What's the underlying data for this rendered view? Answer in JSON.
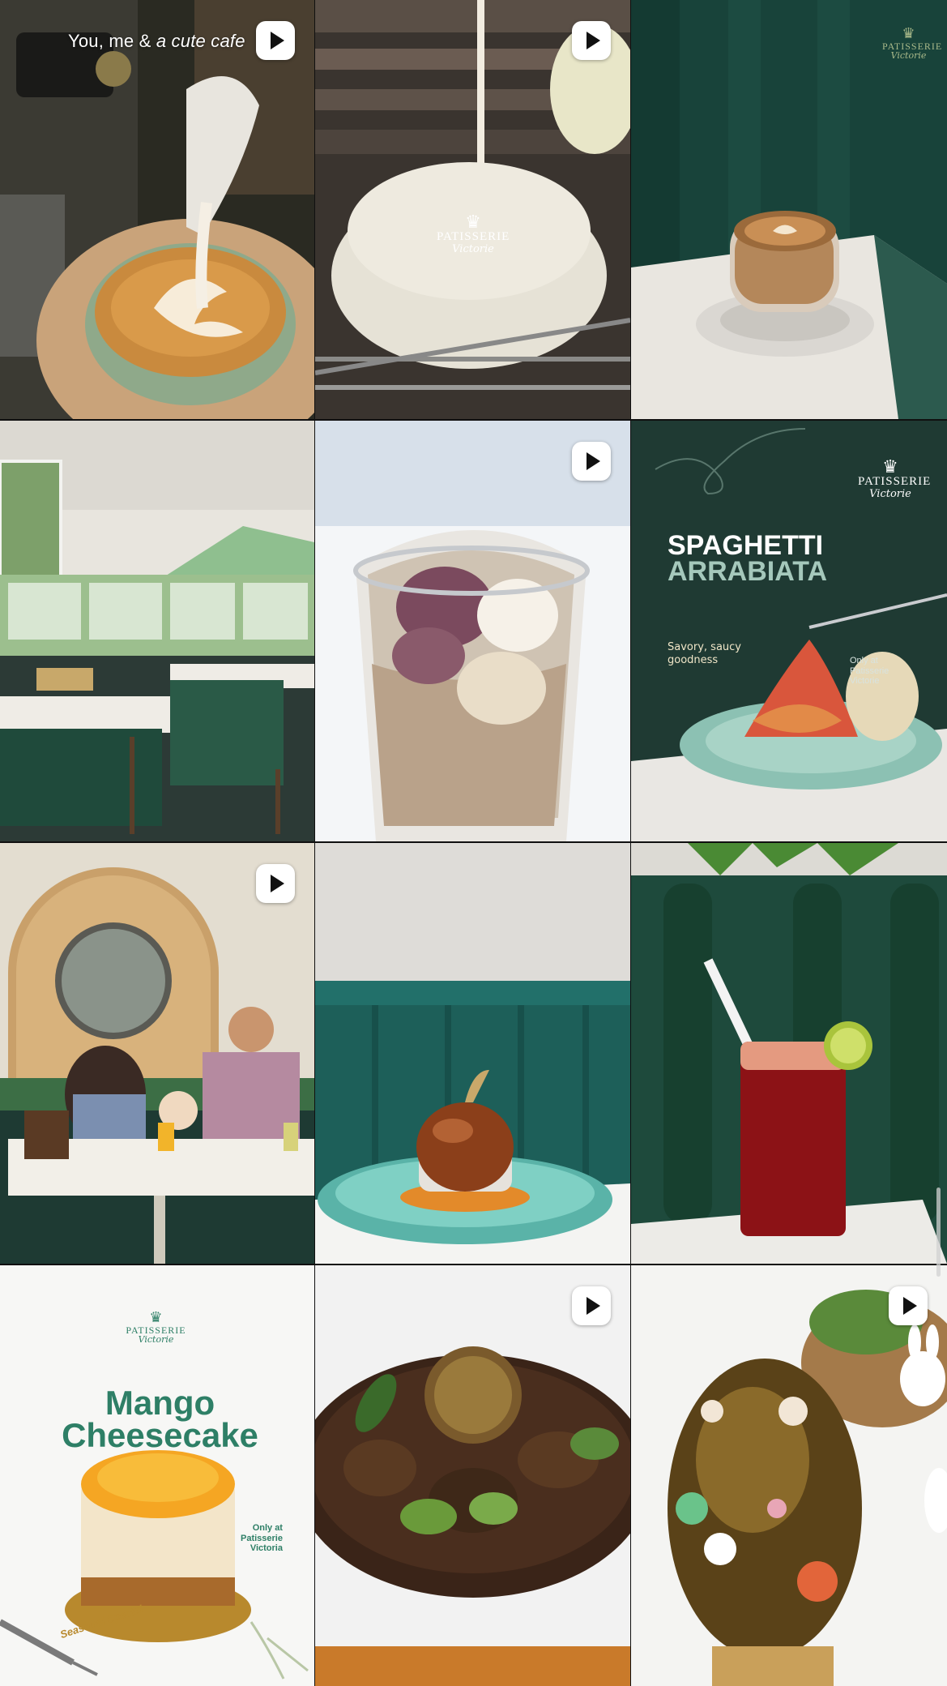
{
  "grid": {
    "tiles": [
      {
        "name": "latte-art-pour",
        "is_reel": true,
        "caption_prefix": "You, me & ",
        "caption_emphasis": "a cute cafe"
      },
      {
        "name": "white-glaze-pour",
        "is_reel": true,
        "brand_name": "PATISSERIE",
        "brand_sub": "Victorie"
      },
      {
        "name": "cappuccino-glass-cup",
        "is_reel": false,
        "brand_name": "PATISSERIE",
        "brand_sub": "Victorie"
      },
      {
        "name": "cafe-interior",
        "is_reel": false
      },
      {
        "name": "rose-iced-latte",
        "is_reel": true
      },
      {
        "name": "spaghetti-arrabiata-post",
        "is_reel": false,
        "brand_name": "PATISSERIE",
        "brand_sub": "Victorie",
        "title_line1": "SPAGHETTI",
        "title_line2": "ARRABIATA",
        "tagline_line1": "Savory, saucy",
        "tagline_line2": "goodness",
        "note_line1": "Only at",
        "note_line2": "Patisserie",
        "note_line3": "Victorie"
      },
      {
        "name": "family-at-cafe",
        "is_reel": true
      },
      {
        "name": "chocolate-dome-dessert",
        "is_reel": false
      },
      {
        "name": "red-iced-drink",
        "is_reel": false
      },
      {
        "name": "mango-cheesecake-post",
        "is_reel": false,
        "brand_name": "PATISSERIE",
        "brand_sub": "Victorie",
        "title_line1": "Mango",
        "title_line2": "Cheesecake",
        "note_line1": "Only at",
        "note_line2": "Patisserie",
        "note_line3": "Victoria",
        "seasonal": "Seasonal Special"
      },
      {
        "name": "chocolate-nest-cake",
        "is_reel": true
      },
      {
        "name": "easter-chocolate-egg",
        "is_reel": true
      }
    ]
  },
  "colors": {
    "brand_green": "#2e7f66",
    "dark_teal": "#1f3a33",
    "reel_badge": "#ffffff"
  }
}
